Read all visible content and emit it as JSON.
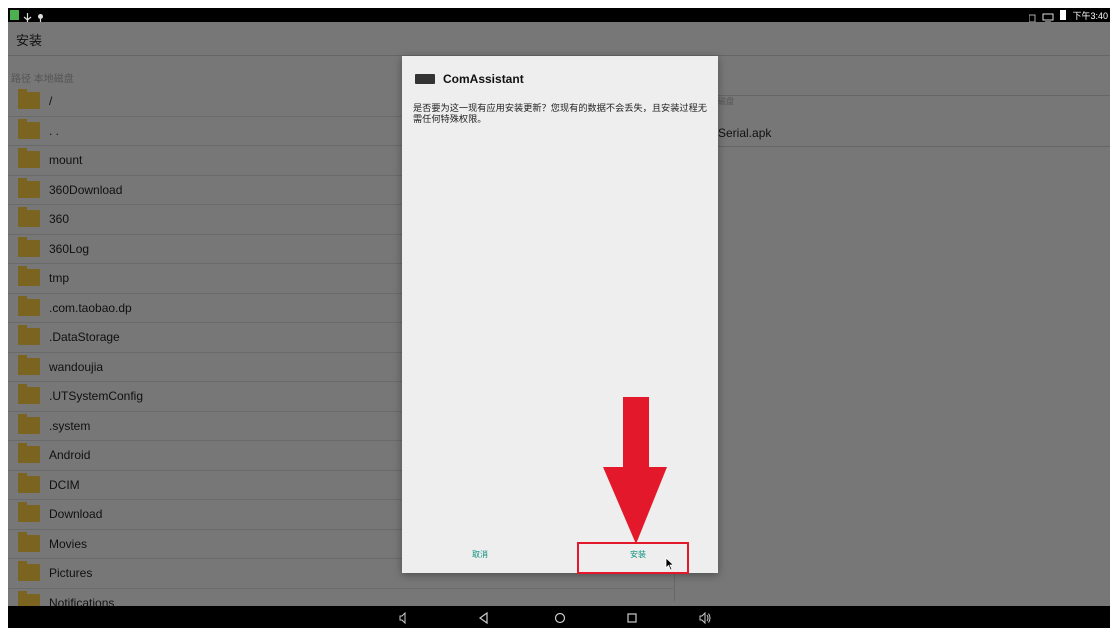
{
  "status_bar": {
    "time": "下午3:40"
  },
  "app": {
    "title": "安装",
    "path_label": "路径  本地磁盘",
    "right_path_label": "磁盘",
    "right_file": "Serial.apk"
  },
  "files": [
    {
      "name": "/"
    },
    {
      "name": ". ."
    },
    {
      "name": "mount"
    },
    {
      "name": "360Download"
    },
    {
      "name": "360"
    },
    {
      "name": "360Log"
    },
    {
      "name": "tmp"
    },
    {
      "name": ".com.taobao.dp"
    },
    {
      "name": ".DataStorage"
    },
    {
      "name": "wandoujia"
    },
    {
      "name": ".UTSystemConfig"
    },
    {
      "name": ".system"
    },
    {
      "name": "Android"
    },
    {
      "name": "DCIM"
    },
    {
      "name": "Download"
    },
    {
      "name": "Movies"
    },
    {
      "name": "Pictures"
    },
    {
      "name": "Notifications"
    }
  ],
  "dialog": {
    "title": "ComAssistant",
    "message": "是否要为这一现有应用安装更新？您现有的数据不会丢失，且安装过程无需任何特殊权限。",
    "cancel_label": "取消",
    "install_label": "安装"
  },
  "colors": {
    "accent_teal": "#0a8f7c",
    "annotation_red": "#e3182b",
    "folder": "#7a6420"
  },
  "icons": {
    "nav": [
      "volume-down-icon",
      "back-icon",
      "home-icon",
      "recents-icon",
      "volume-up-icon"
    ]
  }
}
